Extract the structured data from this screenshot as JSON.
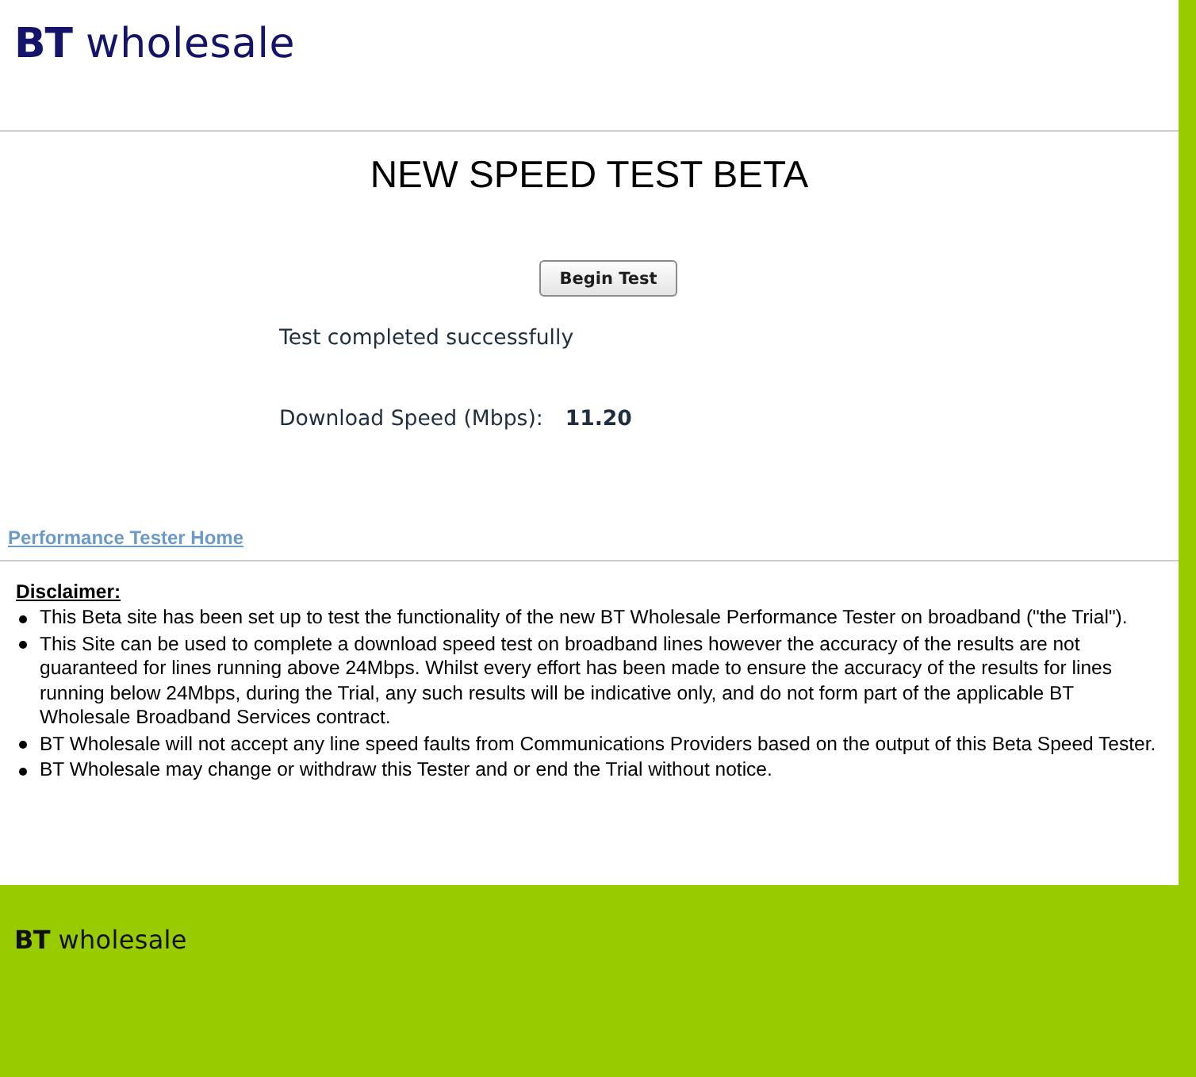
{
  "header": {
    "logo": {
      "mark": "BT",
      "name": "wholesale"
    }
  },
  "title": "NEW SPEED TEST BETA",
  "begin_button": "Begin Test",
  "status": "Test completed successfully",
  "result": {
    "label": "Download Speed (Mbps):",
    "value": "11.20"
  },
  "home_link": "Performance Tester Home",
  "disclaimer": {
    "heading": "Disclaimer:",
    "items": [
      "This Beta site has been set up to test the functionality of the new BT Wholesale Performance Tester on broadband (\"the Trial\").",
      "This Site can be used to complete a download speed test on broadband lines however the accuracy of the results are not guaranteed for lines running above 24Mbps. Whilst every effort has been made to ensure the accuracy of the results for lines running below 24Mbps, during the Trial, any such results will be indicative only, and do not form part of the applicable BT Wholesale Broadband Services contract.",
      "BT Wholesale will not accept any line speed faults from Communications Providers based on the output of this Beta Speed Tester.",
      "BT Wholesale may change or withdraw this Tester and or end the Trial without notice."
    ]
  },
  "footer": {
    "logo": {
      "mark": "BT",
      "name": "wholesale"
    }
  }
}
